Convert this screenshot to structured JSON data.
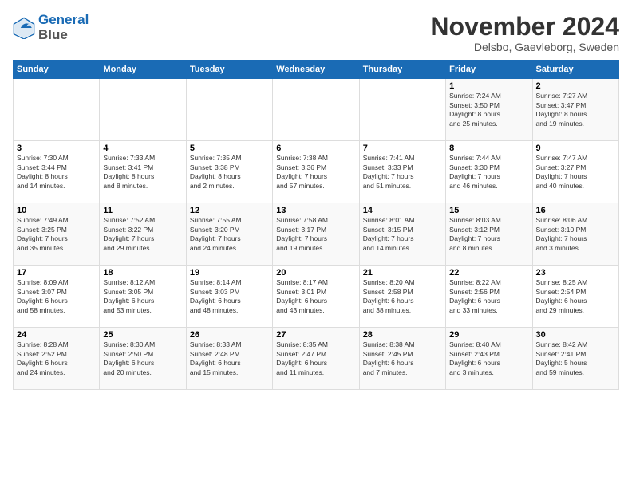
{
  "logo": {
    "line1": "General",
    "line2": "Blue"
  },
  "title": "November 2024",
  "location": "Delsbo, Gaevleborg, Sweden",
  "days_header": [
    "Sunday",
    "Monday",
    "Tuesday",
    "Wednesday",
    "Thursday",
    "Friday",
    "Saturday"
  ],
  "weeks": [
    [
      {
        "num": "",
        "info": ""
      },
      {
        "num": "",
        "info": ""
      },
      {
        "num": "",
        "info": ""
      },
      {
        "num": "",
        "info": ""
      },
      {
        "num": "",
        "info": ""
      },
      {
        "num": "1",
        "info": "Sunrise: 7:24 AM\nSunset: 3:50 PM\nDaylight: 8 hours\nand 25 minutes."
      },
      {
        "num": "2",
        "info": "Sunrise: 7:27 AM\nSunset: 3:47 PM\nDaylight: 8 hours\nand 19 minutes."
      }
    ],
    [
      {
        "num": "3",
        "info": "Sunrise: 7:30 AM\nSunset: 3:44 PM\nDaylight: 8 hours\nand 14 minutes."
      },
      {
        "num": "4",
        "info": "Sunrise: 7:33 AM\nSunset: 3:41 PM\nDaylight: 8 hours\nand 8 minutes."
      },
      {
        "num": "5",
        "info": "Sunrise: 7:35 AM\nSunset: 3:38 PM\nDaylight: 8 hours\nand 2 minutes."
      },
      {
        "num": "6",
        "info": "Sunrise: 7:38 AM\nSunset: 3:36 PM\nDaylight: 7 hours\nand 57 minutes."
      },
      {
        "num": "7",
        "info": "Sunrise: 7:41 AM\nSunset: 3:33 PM\nDaylight: 7 hours\nand 51 minutes."
      },
      {
        "num": "8",
        "info": "Sunrise: 7:44 AM\nSunset: 3:30 PM\nDaylight: 7 hours\nand 46 minutes."
      },
      {
        "num": "9",
        "info": "Sunrise: 7:47 AM\nSunset: 3:27 PM\nDaylight: 7 hours\nand 40 minutes."
      }
    ],
    [
      {
        "num": "10",
        "info": "Sunrise: 7:49 AM\nSunset: 3:25 PM\nDaylight: 7 hours\nand 35 minutes."
      },
      {
        "num": "11",
        "info": "Sunrise: 7:52 AM\nSunset: 3:22 PM\nDaylight: 7 hours\nand 29 minutes."
      },
      {
        "num": "12",
        "info": "Sunrise: 7:55 AM\nSunset: 3:20 PM\nDaylight: 7 hours\nand 24 minutes."
      },
      {
        "num": "13",
        "info": "Sunrise: 7:58 AM\nSunset: 3:17 PM\nDaylight: 7 hours\nand 19 minutes."
      },
      {
        "num": "14",
        "info": "Sunrise: 8:01 AM\nSunset: 3:15 PM\nDaylight: 7 hours\nand 14 minutes."
      },
      {
        "num": "15",
        "info": "Sunrise: 8:03 AM\nSunset: 3:12 PM\nDaylight: 7 hours\nand 8 minutes."
      },
      {
        "num": "16",
        "info": "Sunrise: 8:06 AM\nSunset: 3:10 PM\nDaylight: 7 hours\nand 3 minutes."
      }
    ],
    [
      {
        "num": "17",
        "info": "Sunrise: 8:09 AM\nSunset: 3:07 PM\nDaylight: 6 hours\nand 58 minutes."
      },
      {
        "num": "18",
        "info": "Sunrise: 8:12 AM\nSunset: 3:05 PM\nDaylight: 6 hours\nand 53 minutes."
      },
      {
        "num": "19",
        "info": "Sunrise: 8:14 AM\nSunset: 3:03 PM\nDaylight: 6 hours\nand 48 minutes."
      },
      {
        "num": "20",
        "info": "Sunrise: 8:17 AM\nSunset: 3:01 PM\nDaylight: 6 hours\nand 43 minutes."
      },
      {
        "num": "21",
        "info": "Sunrise: 8:20 AM\nSunset: 2:58 PM\nDaylight: 6 hours\nand 38 minutes."
      },
      {
        "num": "22",
        "info": "Sunrise: 8:22 AM\nSunset: 2:56 PM\nDaylight: 6 hours\nand 33 minutes."
      },
      {
        "num": "23",
        "info": "Sunrise: 8:25 AM\nSunset: 2:54 PM\nDaylight: 6 hours\nand 29 minutes."
      }
    ],
    [
      {
        "num": "24",
        "info": "Sunrise: 8:28 AM\nSunset: 2:52 PM\nDaylight: 6 hours\nand 24 minutes."
      },
      {
        "num": "25",
        "info": "Sunrise: 8:30 AM\nSunset: 2:50 PM\nDaylight: 6 hours\nand 20 minutes."
      },
      {
        "num": "26",
        "info": "Sunrise: 8:33 AM\nSunset: 2:48 PM\nDaylight: 6 hours\nand 15 minutes."
      },
      {
        "num": "27",
        "info": "Sunrise: 8:35 AM\nSunset: 2:47 PM\nDaylight: 6 hours\nand 11 minutes."
      },
      {
        "num": "28",
        "info": "Sunrise: 8:38 AM\nSunset: 2:45 PM\nDaylight: 6 hours\nand 7 minutes."
      },
      {
        "num": "29",
        "info": "Sunrise: 8:40 AM\nSunset: 2:43 PM\nDaylight: 6 hours\nand 3 minutes."
      },
      {
        "num": "30",
        "info": "Sunrise: 8:42 AM\nSunset: 2:41 PM\nDaylight: 5 hours\nand 59 minutes."
      }
    ]
  ]
}
